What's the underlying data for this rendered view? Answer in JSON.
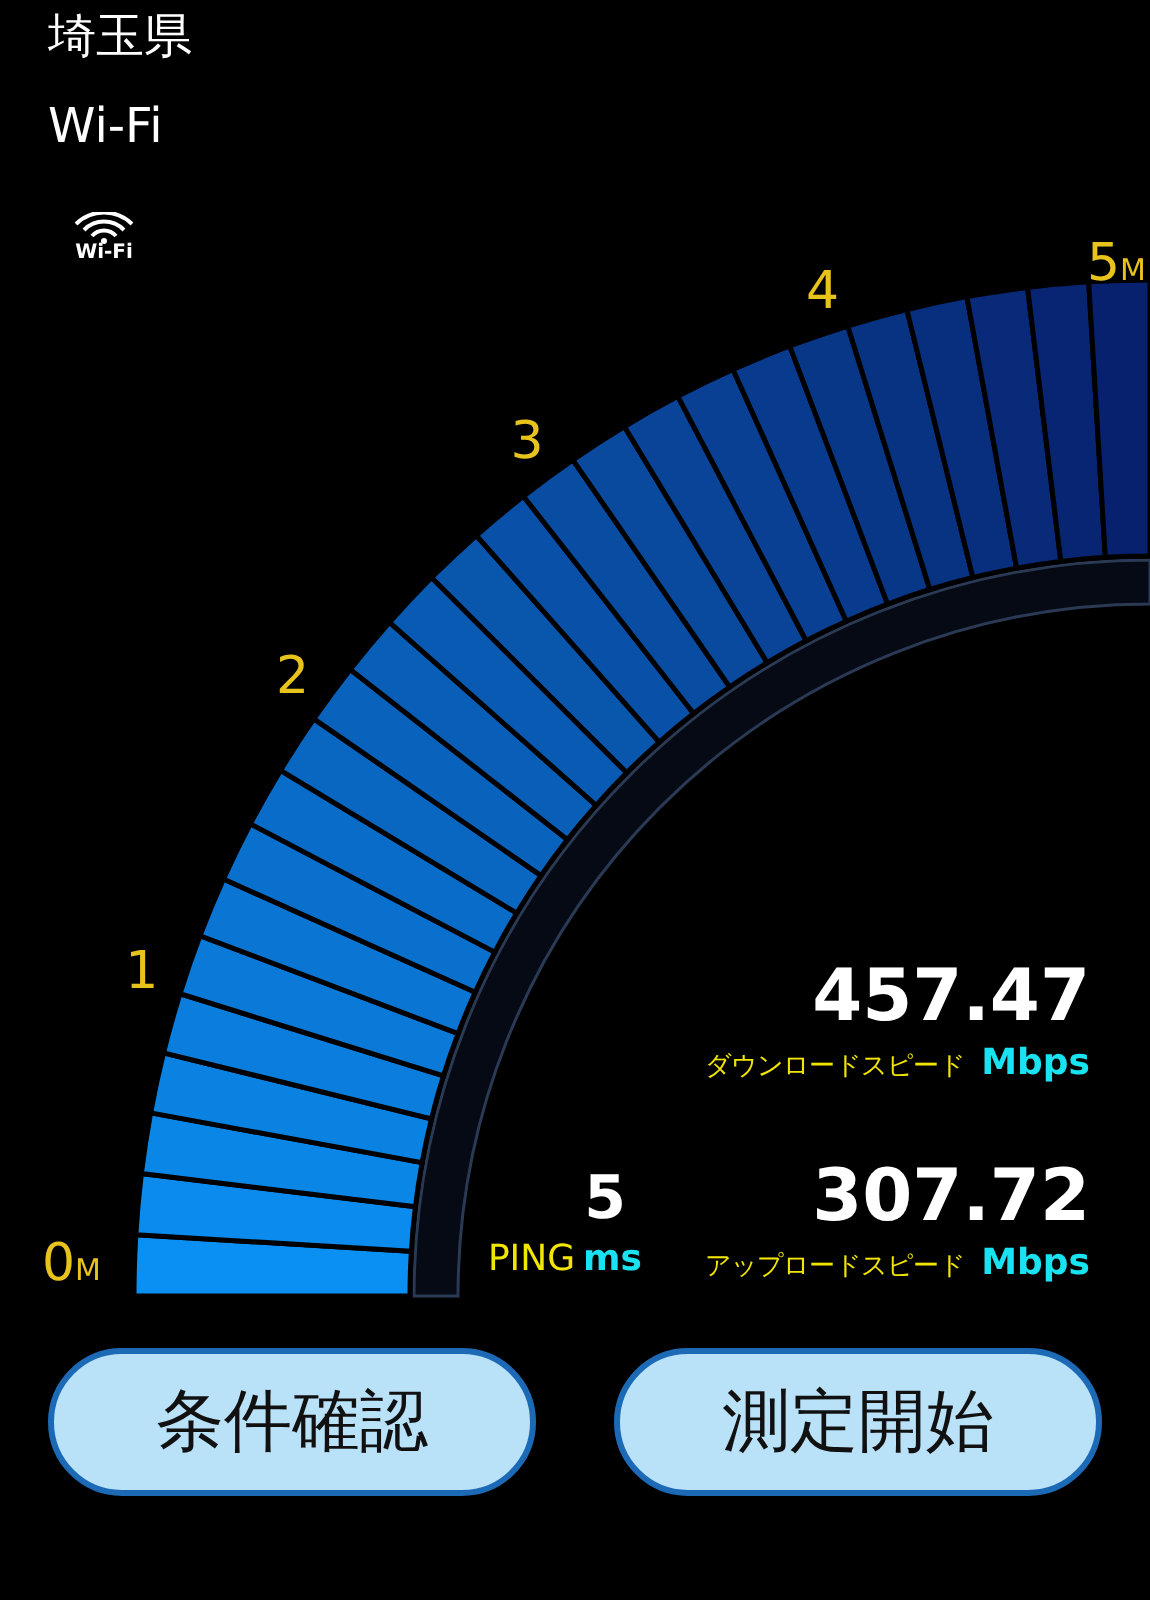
{
  "header": {
    "location": "埼玉県",
    "connection": "Wi-Fi"
  },
  "wifi_badge": {
    "label": "Wi-Fi"
  },
  "gauge": {
    "ticks": [
      {
        "label": "0",
        "unit": "M"
      },
      {
        "label": "1"
      },
      {
        "label": "2"
      },
      {
        "label": "3"
      },
      {
        "label": "4"
      },
      {
        "label": "5",
        "unit": "M"
      }
    ]
  },
  "results": {
    "download": {
      "value": "457.47",
      "label": "ダウンロードスピード",
      "unit": "Mbps"
    },
    "upload": {
      "value": "307.72",
      "label": "アップロードスピード",
      "unit": "Mbps"
    },
    "ping": {
      "value": "5",
      "label": "PING",
      "unit": "ms"
    }
  },
  "buttons": [
    {
      "label": "条件確認"
    },
    {
      "label": "測定開始"
    }
  ]
}
